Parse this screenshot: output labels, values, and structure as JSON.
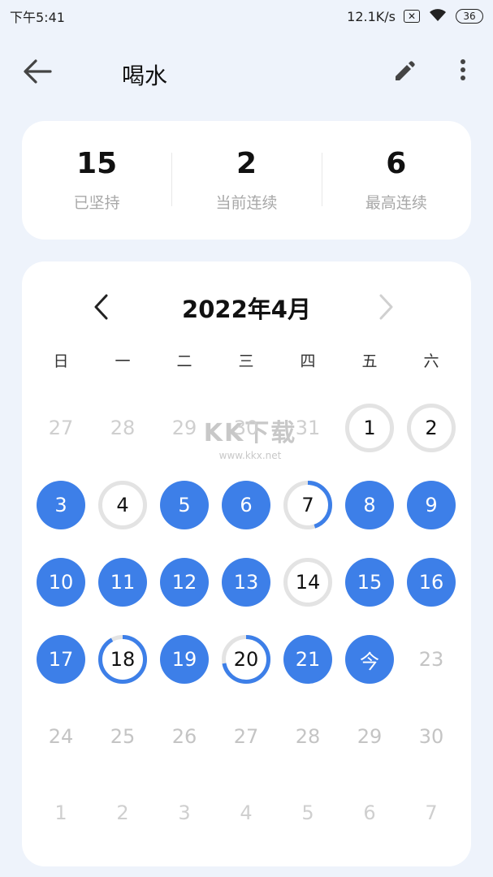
{
  "status": {
    "time": "下午5:41",
    "network_speed": "12.1K/s",
    "sim_icon": "no-sim-icon",
    "wifi_icon": "wifi-icon",
    "battery": "36"
  },
  "app_bar": {
    "title": "喝水",
    "back_icon": "arrow-left-icon",
    "edit_icon": "pencil-icon",
    "more_icon": "more-vertical-icon"
  },
  "stats": [
    {
      "value": "15",
      "label": "已坚持"
    },
    {
      "value": "2",
      "label": "当前连续"
    },
    {
      "value": "6",
      "label": "最高连续"
    }
  ],
  "calendar": {
    "month_title": "2022年4月",
    "prev_icon": "chevron-left-icon",
    "next_icon": "chevron-right-icon",
    "weekdays": [
      "日",
      "一",
      "二",
      "三",
      "四",
      "五",
      "六"
    ],
    "accent_color": "#3d7fe8",
    "ring_track_color": "#e3e3e3",
    "days": [
      {
        "label": "27",
        "state": "other"
      },
      {
        "label": "28",
        "state": "other"
      },
      {
        "label": "29",
        "state": "other"
      },
      {
        "label": "30",
        "state": "other"
      },
      {
        "label": "31",
        "state": "other"
      },
      {
        "label": "1",
        "state": "partial",
        "progress": 0
      },
      {
        "label": "2",
        "state": "partial",
        "progress": 0
      },
      {
        "label": "3",
        "state": "done"
      },
      {
        "label": "4",
        "state": "partial",
        "progress": 0
      },
      {
        "label": "5",
        "state": "done"
      },
      {
        "label": "6",
        "state": "done"
      },
      {
        "label": "7",
        "state": "partial",
        "progress": 0.45
      },
      {
        "label": "8",
        "state": "done"
      },
      {
        "label": "9",
        "state": "done"
      },
      {
        "label": "10",
        "state": "done"
      },
      {
        "label": "11",
        "state": "done"
      },
      {
        "label": "12",
        "state": "done"
      },
      {
        "label": "13",
        "state": "done"
      },
      {
        "label": "14",
        "state": "partial",
        "progress": 0
      },
      {
        "label": "15",
        "state": "done"
      },
      {
        "label": "16",
        "state": "done"
      },
      {
        "label": "17",
        "state": "done"
      },
      {
        "label": "18",
        "state": "partial",
        "progress": 0.92
      },
      {
        "label": "19",
        "state": "done"
      },
      {
        "label": "20",
        "state": "partial",
        "progress": 0.72
      },
      {
        "label": "21",
        "state": "done"
      },
      {
        "label": "今",
        "state": "done"
      },
      {
        "label": "23",
        "state": "blank"
      },
      {
        "label": "24",
        "state": "blank"
      },
      {
        "label": "25",
        "state": "blank"
      },
      {
        "label": "26",
        "state": "blank"
      },
      {
        "label": "27",
        "state": "blank"
      },
      {
        "label": "28",
        "state": "blank"
      },
      {
        "label": "29",
        "state": "blank"
      },
      {
        "label": "30",
        "state": "blank"
      },
      {
        "label": "1",
        "state": "other"
      },
      {
        "label": "2",
        "state": "other"
      },
      {
        "label": "3",
        "state": "other"
      },
      {
        "label": "4",
        "state": "other"
      },
      {
        "label": "5",
        "state": "other"
      },
      {
        "label": "6",
        "state": "other"
      },
      {
        "label": "7",
        "state": "other"
      }
    ]
  },
  "watermark": {
    "main": "KK下载",
    "sub": "www.kkx.net"
  }
}
